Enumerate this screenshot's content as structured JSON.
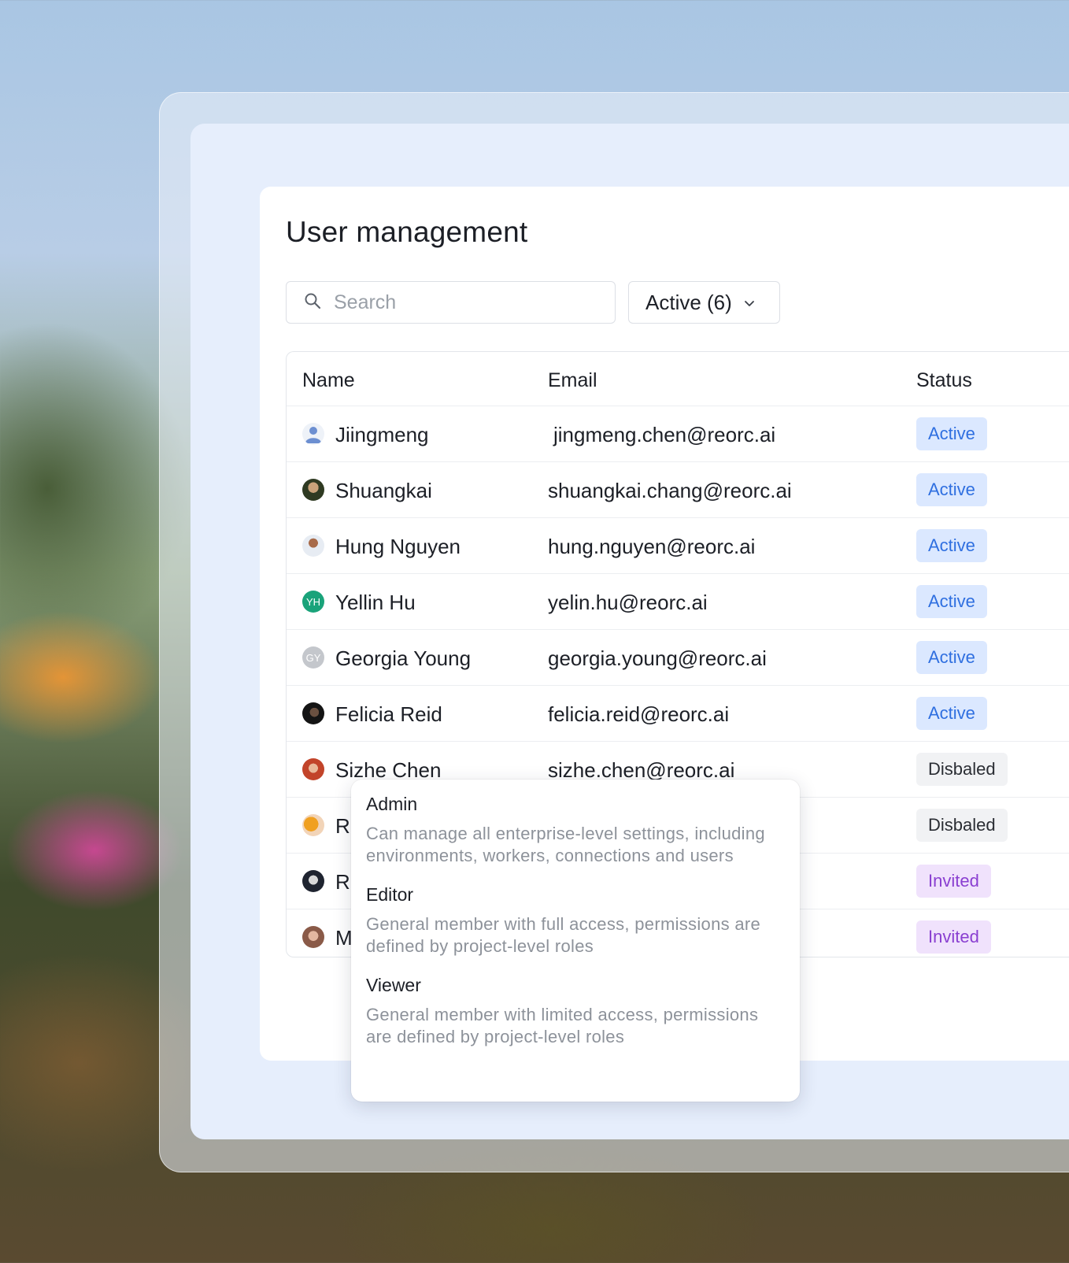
{
  "page": {
    "title": "User management"
  },
  "search": {
    "placeholder": "Search",
    "icon": "search-icon"
  },
  "filter": {
    "label": "Active (6)",
    "icon": "chevron-down-icon"
  },
  "table": {
    "columns": {
      "name": "Name",
      "email": "Email",
      "status": "Status"
    },
    "rows": [
      {
        "name": "Jiingmeng",
        "email": "jingmeng.chen@reorc.ai",
        "status": "Active",
        "avatar": ""
      },
      {
        "name": "Shuangkai",
        "email": "shuangkai.chang@reorc.ai",
        "status": "Active",
        "avatar": ""
      },
      {
        "name": "Hung Nguyen",
        "email": "hung.nguyen@reorc.ai",
        "status": "Active",
        "avatar": ""
      },
      {
        "name": "Yellin Hu",
        "email": "yelin.hu@reorc.ai",
        "status": "Active",
        "avatar": "YH"
      },
      {
        "name": "Georgia Young",
        "email": "georgia.young@reorc.ai",
        "status": "Active",
        "avatar": "GY"
      },
      {
        "name": "Felicia Reid",
        "email": "felicia.reid@reorc.ai",
        "status": "Active",
        "avatar": ""
      },
      {
        "name": "Sizhe Chen",
        "email": "sizhe.chen@reorc.ai",
        "status": "Disbaled",
        "avatar": ""
      },
      {
        "name": "R",
        "email": "",
        "status": "Disbaled",
        "avatar": ""
      },
      {
        "name": "R",
        "email": "",
        "status": "Invited",
        "avatar": ""
      },
      {
        "name": "M",
        "email": "",
        "status": "Invited",
        "avatar": ""
      }
    ]
  },
  "roles_popover": {
    "items": [
      {
        "title": "Admin",
        "description": "Can manage all enterprise-level settings, including environments, workers, connections and users"
      },
      {
        "title": "Editor",
        "description": "General member with full access, permissions are defined by project-level roles"
      },
      {
        "title": "Viewer",
        "description": "General member with limited access, permissions are defined by project-level roles"
      }
    ]
  },
  "colors": {
    "active_bg": "#dbe8ff",
    "active_text": "#2f6fe0",
    "disabled_bg": "#f1f2f4",
    "invited_bg": "#f0e2fc",
    "invited_text": "#8a3fd1"
  }
}
